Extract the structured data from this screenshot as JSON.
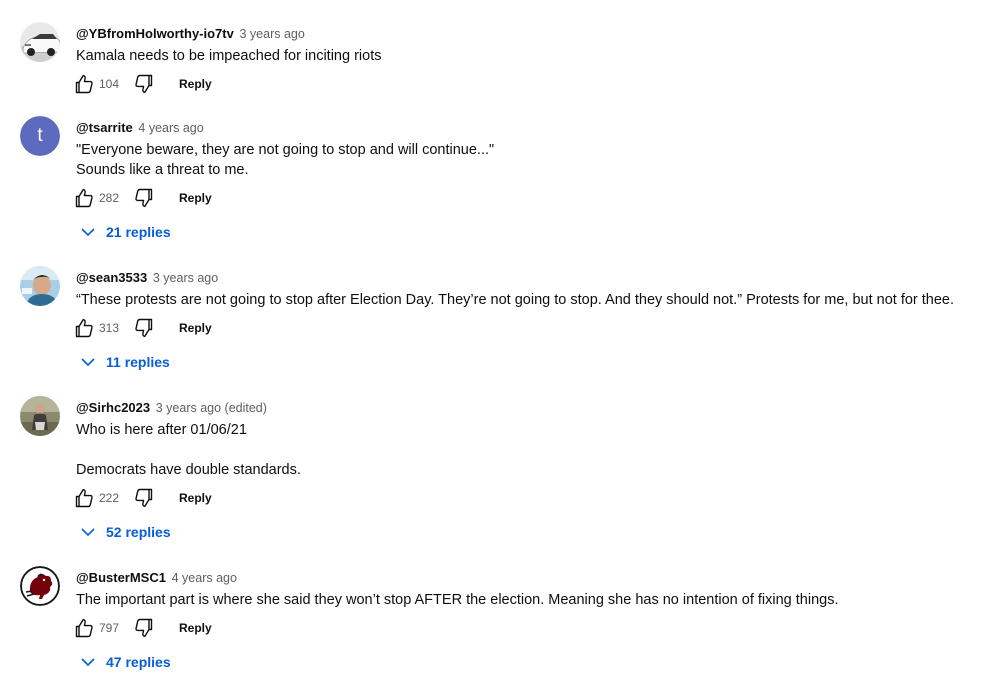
{
  "comments": [
    {
      "author": "@YBfromHolworthy-io7tv",
      "time": "3 years ago",
      "lines": [
        "Kamala needs to be impeached for inciting riots"
      ],
      "likes": "104",
      "reply_label": "Reply",
      "avatar_icon": "car-avatar-icon"
    },
    {
      "author": "@tsarrite",
      "time": "4 years ago",
      "lines": [
        "\"Everyone beware, they are not going to stop and will continue...\"",
        "Sounds like a threat to me."
      ],
      "likes": "282",
      "reply_label": "Reply",
      "avatar_letter": "t",
      "avatar_color": "#5c6bc0",
      "replies": "21 replies"
    },
    {
      "author": "@sean3533",
      "time": "3 years ago",
      "lines": [
        "“These protests are not going to stop after Election Day. They’re not going to stop. And they should not.” Protests for me, but not for thee."
      ],
      "likes": "313",
      "reply_label": "Reply",
      "avatar_icon": "person-photo-avatar-icon",
      "replies": "11 replies"
    },
    {
      "author": "@Sirhc2023",
      "time": "3 years ago (edited)",
      "lines": [
        "Who is here after 01/06/21",
        "",
        "Democrats have double standards."
      ],
      "likes": "222",
      "reply_label": "Reply",
      "avatar_icon": "outdoor-photo-avatar-icon",
      "replies": "52 replies"
    },
    {
      "author": "@BusterMSC1",
      "time": "4 years ago",
      "lines": [
        "The important part is where she said they won’t stop AFTER the election. Meaning she has no intention of fixing things."
      ],
      "likes": "797",
      "reply_label": "Reply",
      "avatar_icon": "gamecock-logo-avatar-icon",
      "replies": "47 replies"
    }
  ],
  "colors": {
    "link_blue": "#065fd4",
    "secondary_text": "#606060",
    "primary_text": "#0f0f0f"
  }
}
